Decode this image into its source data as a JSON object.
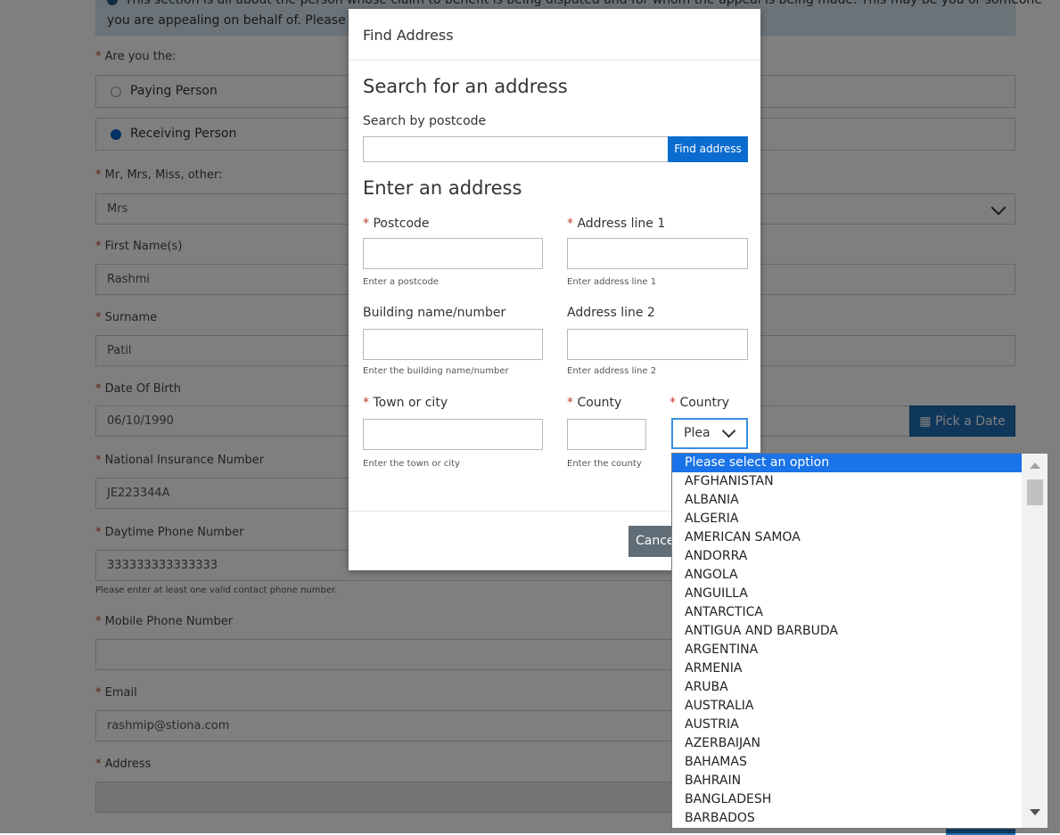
{
  "banner": {
    "line1": "This section is all about the person whose claim to benefit is being disputed and for whom the appeal is being made. This may be you or someone",
    "line2": "you are appealing on behalf of. Please co"
  },
  "form": {
    "are_you_label": "Are you the:",
    "paying_person": "Paying Person",
    "receiving_person": "Receiving Person",
    "title_label": "Mr, Mrs, Miss, other:",
    "title_value": "Mrs",
    "first_name_label": "First Name(s)",
    "first_name_value": "Rashmi",
    "surname_label": "Surname",
    "surname_value": "Patil",
    "dob_label": "Date Of Birth",
    "dob_value": "06/10/1990",
    "pick_date": "Pick a Date",
    "ni_label": "National Insurance Number",
    "ni_value": "JE223344A",
    "daytime_label": "Daytime Phone Number",
    "daytime_value": "333333333333333",
    "phone_hint": "Please enter at least one valid contact phone number.",
    "mobile_label": "Mobile Phone Number",
    "mobile_value": "",
    "email_label": "Email",
    "email_value": "rashmip@stiona.com",
    "address_label": "Address",
    "required_mark": "*"
  },
  "modal": {
    "title": "Find Address",
    "search_heading": "Search for an address",
    "search_label": "Search by postcode",
    "find_button": "Find address",
    "enter_heading": "Enter an address",
    "postcode_label": "Postcode",
    "postcode_hint": "Enter a postcode",
    "address1_label": "Address line 1",
    "address1_hint": "Enter address line 1",
    "building_label": "Building name/number",
    "building_hint": "Enter the building name/number",
    "address2_label": "Address line 2",
    "address2_hint": "Enter address line 2",
    "town_label": "Town or city",
    "town_hint": "Enter the town or city",
    "county_label": "County",
    "county_hint": "Enter the county",
    "country_label": "Country",
    "country_value": "Plea",
    "cancel_button": "Cance"
  },
  "dropdown": {
    "options": [
      "Please select an option",
      "AFGHANISTAN",
      "ALBANIA",
      "ALGERIA",
      "AMERICAN SAMOA",
      "ANDORRA",
      "ANGOLA",
      "ANGUILLA",
      "ANTARCTICA",
      "ANTIGUA AND BARBUDA",
      "ARGENTINA",
      "ARMENIA",
      "ARUBA",
      "AUSTRALIA",
      "AUSTRIA",
      "AZERBAIJAN",
      "BAHAMAS",
      "BAHRAIN",
      "BANGLADESH",
      "BARBADOS"
    ],
    "selected_index": 0
  },
  "colors": {
    "accent": "#0b6ccf",
    "selected_option": "#1a73e8",
    "required": "#c0392b",
    "overlay": "rgba(0,0,0,0.5)"
  },
  "icons": {
    "calendar": "calendar-icon",
    "chevron": "chevron-down-icon"
  }
}
